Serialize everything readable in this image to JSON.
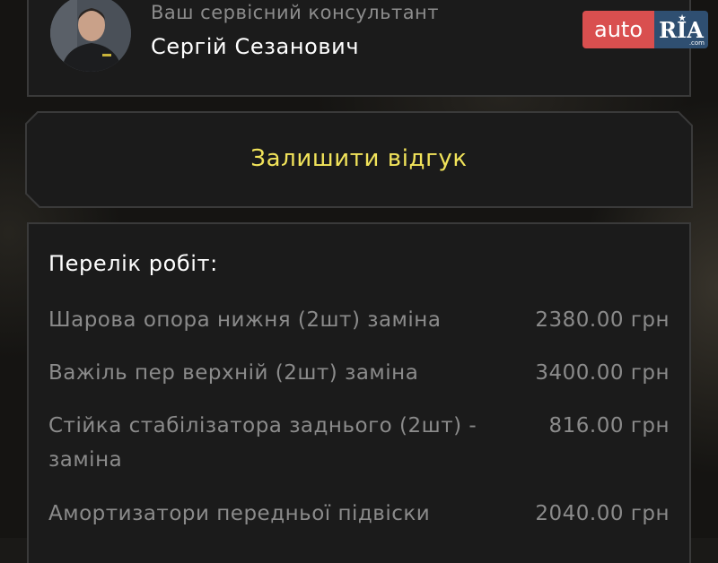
{
  "consultant": {
    "role": "Ваш сервісний консультант",
    "name": "Сергій Сезанович"
  },
  "logo": {
    "auto": "auto",
    "ria": "RIA",
    "com": ".com"
  },
  "feedback": {
    "label": "Залишити відгук"
  },
  "works": {
    "title": "Перелік робіт:",
    "items": [
      {
        "name": "Шарова опора  нижня (2шт) заміна",
        "price": "2380.00 грн"
      },
      {
        "name": "Важіль пер верхній (2шт) заміна",
        "price": "3400.00 грн"
      },
      {
        "name": "Стійка стабілізатора заднього (2шт) - заміна",
        "price": "816.00 грн"
      },
      {
        "name": "Амортизатори передньої підвіски",
        "price": "2040.00 грн"
      }
    ]
  },
  "colors": {
    "accent_yellow": "#f1e35a",
    "card_bg": "#1b1b1b",
    "border": "#3a3a3a",
    "logo_red": "#d94f4f",
    "logo_blue": "#2f4f71"
  }
}
